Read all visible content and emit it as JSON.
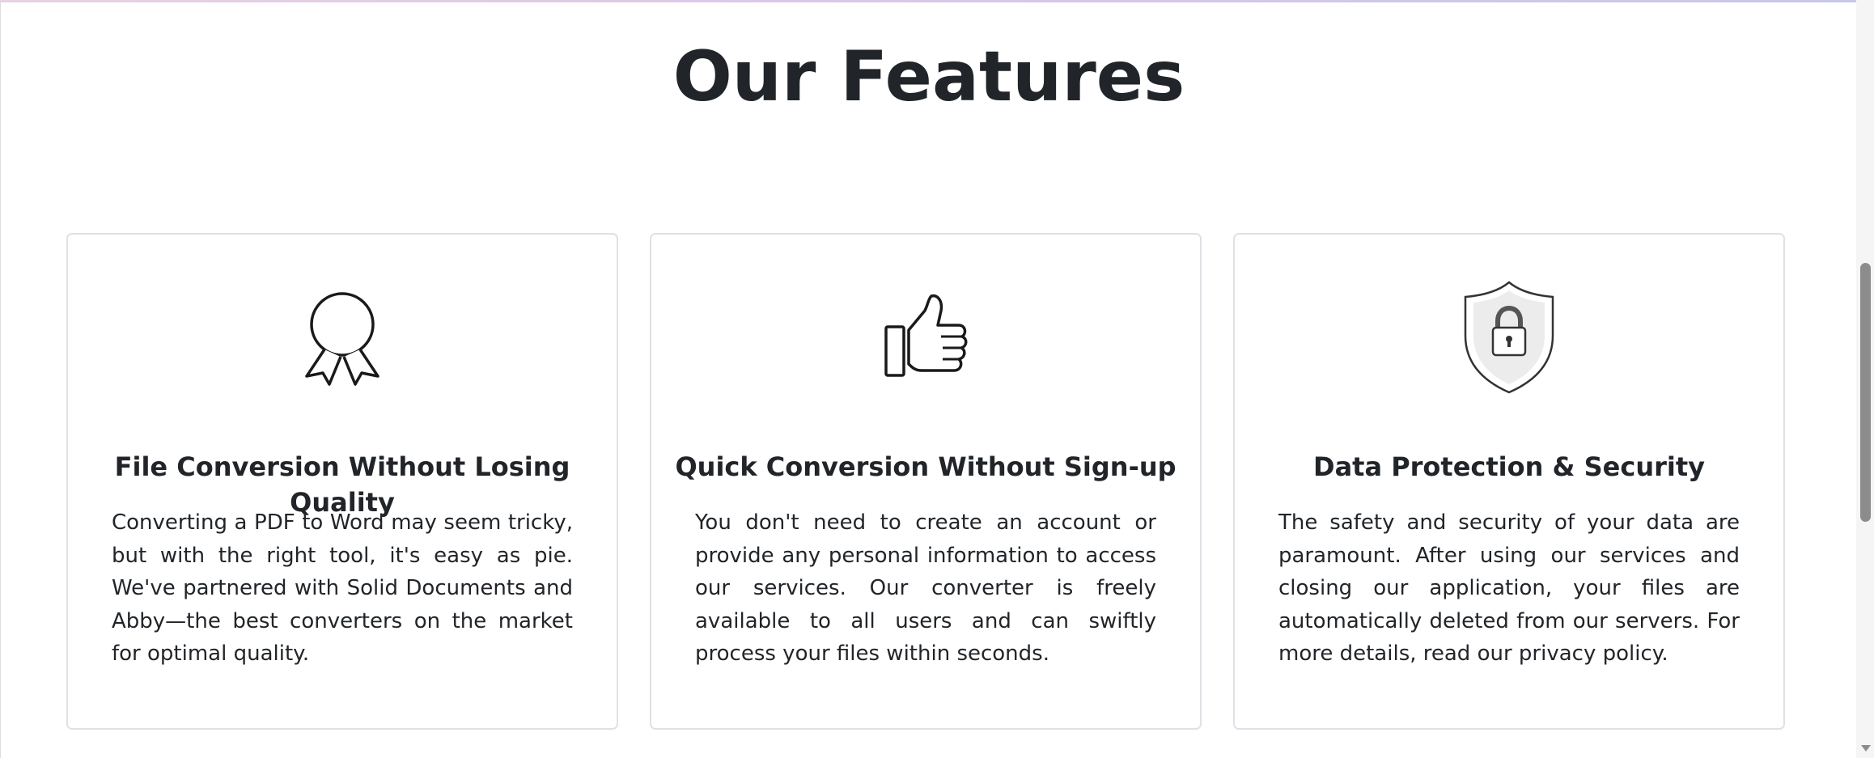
{
  "section": {
    "title": "Our Features"
  },
  "features": [
    {
      "icon": "award-ribbon-icon",
      "title": "File Conversion Without Losing Quality",
      "text": "Converting a PDF to Word may seem tricky, but with the right tool, it's easy as pie. We've partnered with Solid Documents and Abby—the best converters on the market for optimal quality."
    },
    {
      "icon": "thumbs-up-icon",
      "title": "Quick Conversion Without Sign-up",
      "text": "You don't need to create an account or provide any personal information to access our services. Our converter is freely available to all users and can swiftly process your files within seconds."
    },
    {
      "icon": "shield-lock-icon",
      "title": "Data Protection & Security",
      "text": "The safety and security of your data are paramount. After using our services and closing our application, your files are automatically deleted from our servers. For more details, read our privacy policy."
    }
  ]
}
